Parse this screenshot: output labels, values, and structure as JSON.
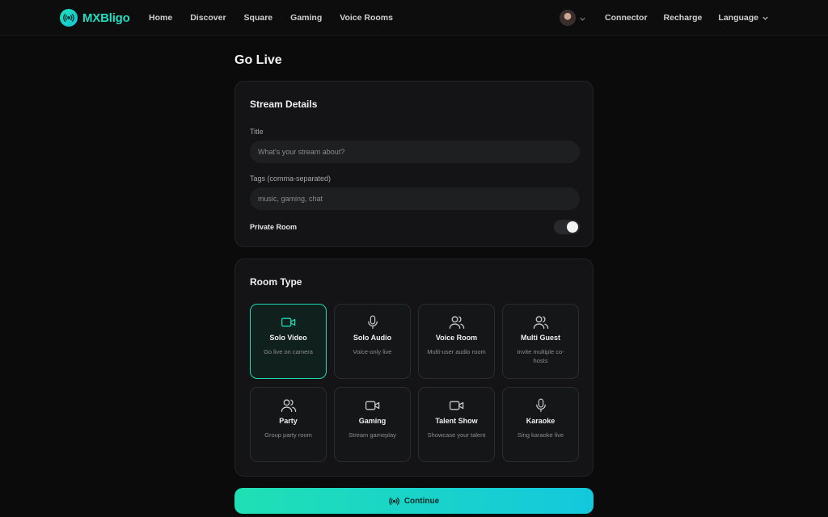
{
  "brand": {
    "name": "MXBligo",
    "color": "#21ddc1"
  },
  "nav": {
    "links": [
      "Home",
      "Discover",
      "Square",
      "Gaming",
      "Voice Rooms"
    ],
    "connector": "Connector",
    "recharge": "Recharge",
    "language": "Language"
  },
  "page": {
    "title": "Go Live"
  },
  "stream_details": {
    "heading": "Stream Details",
    "title_label": "Title",
    "title_placeholder": "What's your stream about?",
    "tags_label": "Tags (comma-separated)",
    "tags_placeholder": "music, gaming, chat",
    "private_label": "Private Room",
    "private_on": true
  },
  "room_type": {
    "heading": "Room Type",
    "selected": "Solo Video",
    "options": [
      {
        "name": "Solo Video",
        "desc": "Go live on camera",
        "icon": "video-camera-icon"
      },
      {
        "name": "Solo Audio",
        "desc": "Voice-only live",
        "icon": "microphone-icon"
      },
      {
        "name": "Voice Room",
        "desc": "Multi-user audio room",
        "icon": "users-icon"
      },
      {
        "name": "Multi Guest",
        "desc": "Invite multiple co-hosts",
        "icon": "users-icon"
      },
      {
        "name": "Party",
        "desc": "Group party room",
        "icon": "users-icon"
      },
      {
        "name": "Gaming",
        "desc": "Stream gameplay",
        "icon": "video-camera-icon"
      },
      {
        "name": "Talent Show",
        "desc": "Showcase your talent",
        "icon": "video-camera-icon"
      },
      {
        "name": "Karaoke",
        "desc": "Sing karaoke live",
        "icon": "microphone-icon"
      }
    ]
  },
  "continue_button": {
    "label": "Continue",
    "icon": "broadcast-icon"
  },
  "colors": {
    "accent": "#1fd8b4",
    "background": "#0b0b0c",
    "card": "#141416"
  }
}
